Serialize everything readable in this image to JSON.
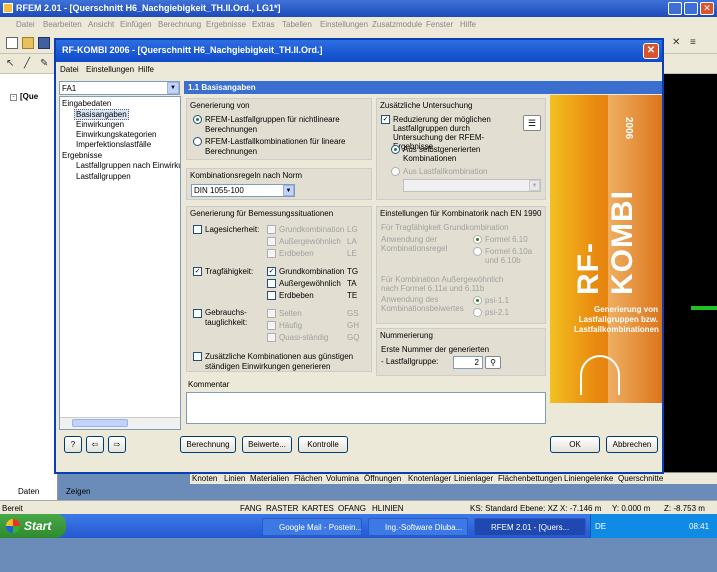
{
  "app": {
    "title": "RFEM 2.01 - [Querschnitt H6_Nachgiebigkeit_TH.II.Ord., LG1*]",
    "menu": [
      "Datei",
      "Bearbeiten",
      "Ansicht",
      "Einfügen",
      "Berechnung",
      "Ergebnisse",
      "Extras",
      "Tabellen",
      "Einstellungen",
      "Zusatzmodule",
      "Fenster",
      "Hilfe"
    ],
    "tree_root": "[Que",
    "left_tabs": [
      "Daten",
      "Zeigen"
    ],
    "bottom_tabs": [
      "Knoten",
      "Linien",
      "Materialien",
      "Flächen",
      "Volumina",
      "Öffnungen",
      "Knotenlager",
      "Linienlager",
      "Flächenbettungen",
      "Liniengelenke",
      "Querschnitte"
    ],
    "status": {
      "left": "Bereit",
      "toggles": [
        "FANG",
        "RASTER",
        "KARTES",
        "OFANG",
        "HLINIEN"
      ],
      "ks": "KS: Standard",
      "ebene": "Ebene: XZ",
      "x": "X: -7.146 m",
      "y": "Y: 0.000 m",
      "z": "Z: -8.753 m"
    }
  },
  "taskbar": {
    "start": "Start",
    "tasks": [
      "Google Mail - Postein...",
      "Ing.-Software Dluba...",
      "RFEM 2.01 - [Quers..."
    ],
    "lang": "DE",
    "clock": "08:41"
  },
  "dialog": {
    "title": "RF-KOMBI 2006 - [Querschnitt H6_Nachgiebigkeit_TH.II.Ord.]",
    "menu": [
      "Datei",
      "Einstellungen",
      "Hilfe"
    ],
    "case_select": "FA1",
    "tree": {
      "eingabedaten": "Eingabedaten",
      "items_in": [
        "Basisangaben",
        "Einwirkungen",
        "Einwirkungskategorien",
        "Imperfektionslastfälle"
      ],
      "ergebnisse": "Ergebnisse",
      "items_out": [
        "Lastfallgruppen nach Einwirkung",
        "Lastfallgruppen"
      ]
    },
    "section_title": "1.1 Basisangaben",
    "generierung": {
      "header": "Generierung von",
      "opt1": "RFEM-Lastfallgruppen für nichtlineare Berechnungen",
      "opt2": "RFEM-Lastfallkombinationen für lineare Berechnungen"
    },
    "norm": {
      "header": "Kombinationsregeln nach Norm",
      "value": "DIN 1055-100"
    },
    "bemessung": {
      "header": "Generierung für Bemessungssituationen",
      "lage_label": "Lagesicherheit:",
      "lage_items": [
        {
          "label": "Grundkombination",
          "code": "LG"
        },
        {
          "label": "Außergewöhnlich",
          "code": "LA"
        },
        {
          "label": "Erdbeben",
          "code": "LE"
        }
      ],
      "trag_label": "Tragfähigkeit:",
      "trag_items": [
        {
          "label": "Grundkombination",
          "code": "TG"
        },
        {
          "label": "Außergewöhnlich",
          "code": "TA"
        },
        {
          "label": "Erdbeben",
          "code": "TE"
        }
      ],
      "geb_label1": "Gebrauchs-",
      "geb_label2": "tauglichkeit:",
      "geb_items": [
        {
          "label": "Selten",
          "code": "GS"
        },
        {
          "label": "Häufig",
          "code": "GH"
        },
        {
          "label": "Quasi-ständig",
          "code": "GQ"
        }
      ],
      "extra1": "Zusätzliche Kombinationen aus günstigen",
      "extra2": "ständigen Einwirkungen generieren"
    },
    "zusatz": {
      "header": "Zusätzliche Untersuchung",
      "reduce": "Reduzierung der möglichen Lastfallgruppen durch Untersuchung der RFEM-Ergebnisse",
      "sub1": "Aus selbstgenerierten Kombinationen",
      "sub2": "Aus Lastfallkombination"
    },
    "einstellungen": {
      "header": "Einstellungen für Kombinatorik nach EN 1990",
      "sub1": "Für Tragfähigkeit Grundkombination",
      "apply1": "Anwendung der Kombinationsregel",
      "f1": "Formel 6.10",
      "f2": "Formel 6.10a und 6.10b",
      "sub2": "Für Kombination Außergewöhnlich nach Formel 6.11a und 6.11b",
      "apply2": "Anwendung des Kombinationsbeiwertes",
      "p1": "psi-1.1",
      "p2": "psi-2.1"
    },
    "nummerierung": {
      "header": "Nummerierung",
      "label": "Erste Nummer der generierten",
      "field": "- Lastfallgruppe:",
      "value": "2"
    },
    "kommentar_header": "Kommentar",
    "banner": {
      "brand": "RF-KOMBI",
      "year": "2006",
      "caption": "Generierung von Lastfallgruppen bzw. Lastfallkombinationen"
    },
    "buttons": {
      "berechnung": "Berechnung",
      "beiwerte": "Beiwerte...",
      "kontrolle": "Kontrolle",
      "ok": "OK",
      "abbrechen": "Abbrechen"
    }
  }
}
